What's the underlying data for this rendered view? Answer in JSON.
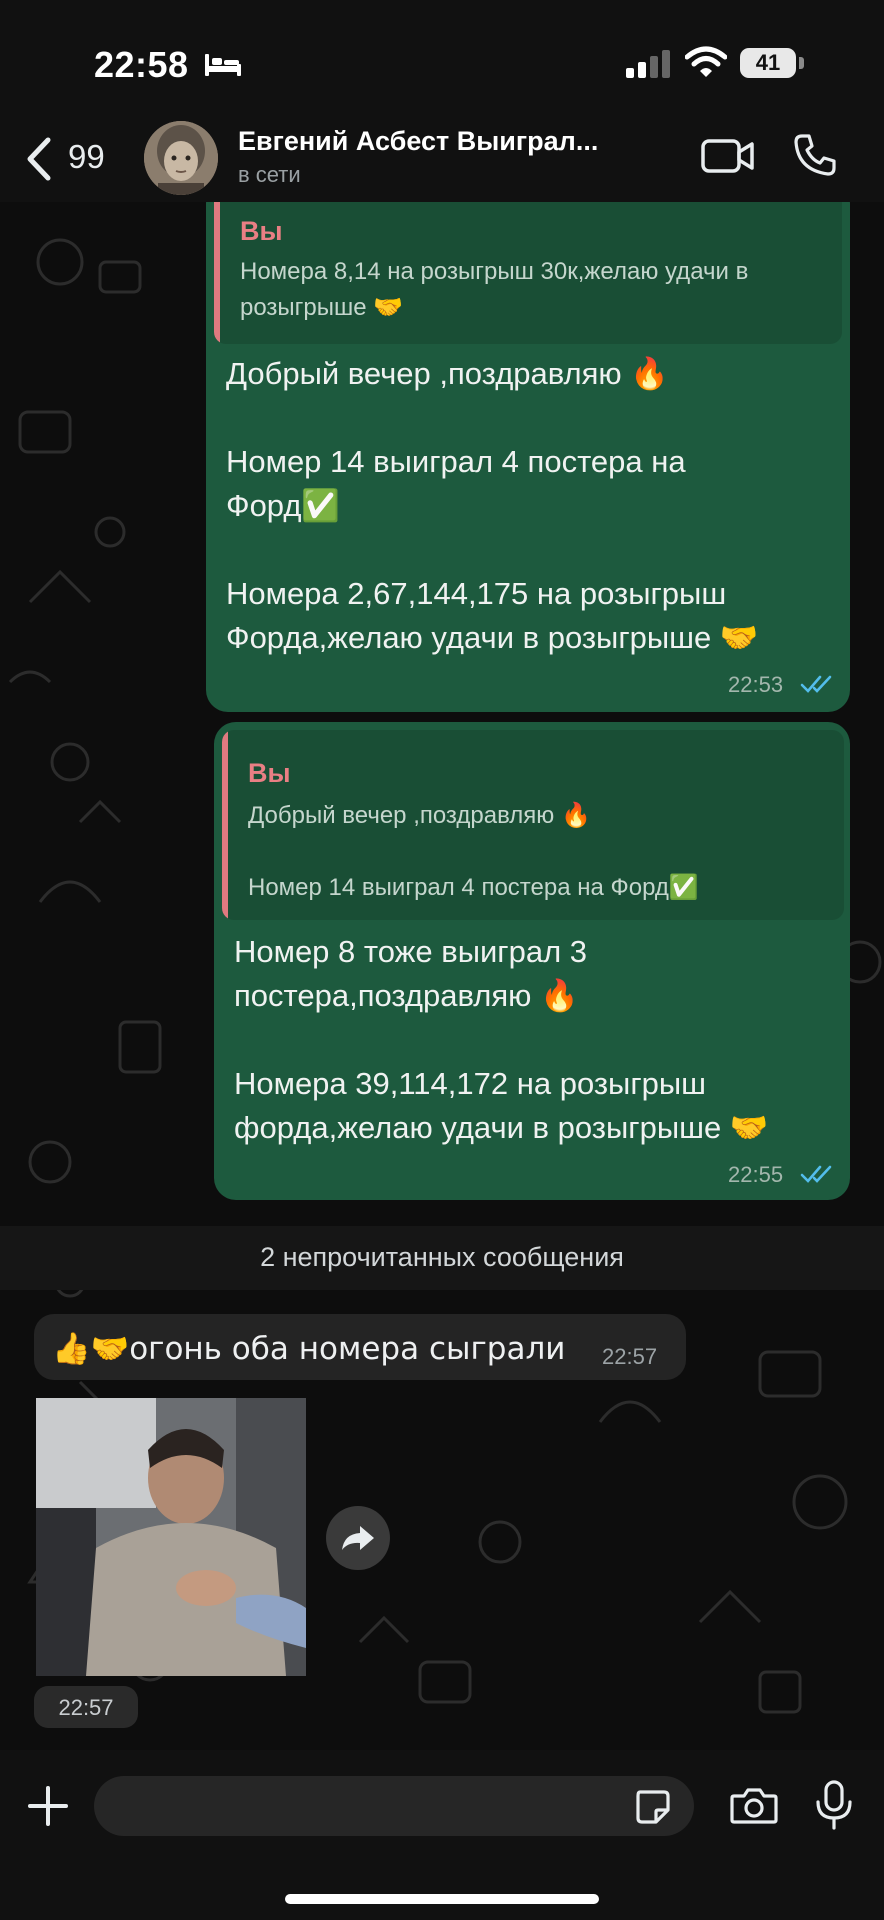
{
  "status_bar": {
    "time": "22:58",
    "battery": "41"
  },
  "header": {
    "back_count": "99",
    "contact_name": "Евгений Асбест Выиграл...",
    "contact_status": "в сети"
  },
  "messages": [
    {
      "quote_author": "Вы",
      "quote_text": "Номера 8,14 на розыгрыш 30к,желаю удачи в\nрозыгрыше 🤝",
      "text": "Добрый вечер ,поздравляю 🔥\n\nНомер 14 выиграл 4 постера на\nФорд✅\n\nНомера 2,67,144,175 на розыгрыш\nФорда,желаю удачи в розыгрыше 🤝",
      "time": "22:53"
    },
    {
      "quote_author": "Вы",
      "quote_text": "Добрый вечер ,поздравляю 🔥\n\nНомер 14 выиграл 4 постера на Форд✅",
      "text": "Номер 8 тоже выиграл 3\nпостера,поздравляю 🔥\n\nНомера 39,114,172 на розыгрыш\nфорда,желаю удачи в розыгрыше 🤝",
      "time": "22:55"
    }
  ],
  "unread_divider": "2 непрочитанных сообщения",
  "incoming": {
    "text": "👍🤝огонь оба номера сыграли",
    "time": "22:57",
    "media_time": "22:57"
  },
  "icons": [
    "back-icon",
    "bed-icon",
    "signal-icon",
    "wifi-icon",
    "video-icon",
    "call-icon",
    "read-checks-icon",
    "forward-icon",
    "plus-icon",
    "sticker-icon",
    "camera-icon",
    "mic-icon"
  ],
  "colors": {
    "outgoing_bubble": "#1d5a3e",
    "quote_accent": "#e07a80",
    "read_checks": "#53bdeb"
  }
}
